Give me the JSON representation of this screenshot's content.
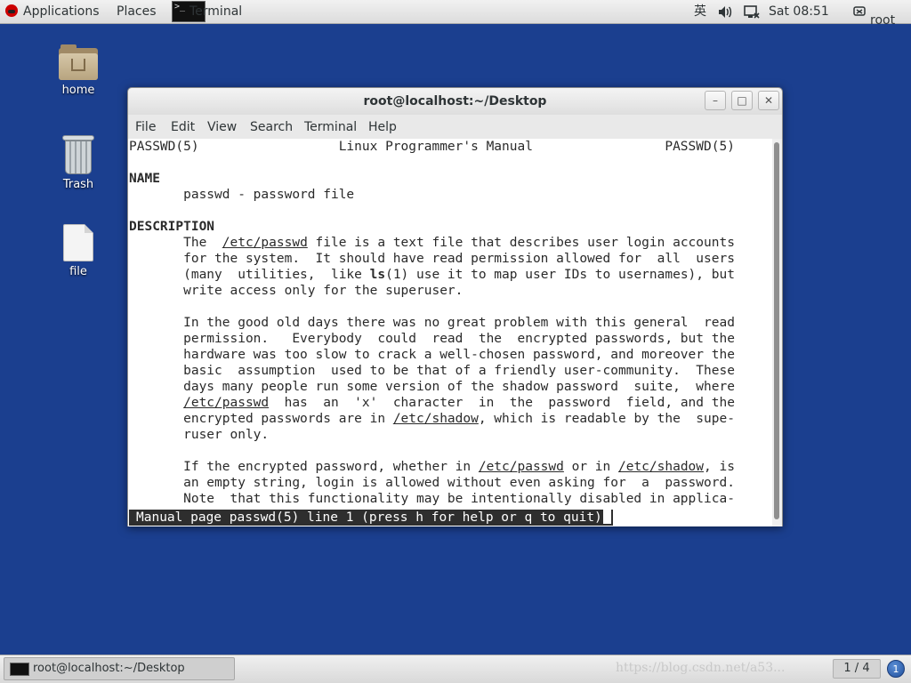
{
  "top_panel": {
    "applications_label": "Applications",
    "places_label": "Places",
    "terminal_label": "Terminal",
    "input_method": "英",
    "clock": "Sat 08:51",
    "user": "root"
  },
  "desktop": {
    "icons": [
      {
        "label": "home",
        "icon": "home-folder-icon"
      },
      {
        "label": "Trash",
        "icon": "trash-icon"
      },
      {
        "label": "file",
        "icon": "file-icon"
      }
    ]
  },
  "window": {
    "title": "root@localhost:~/Desktop",
    "menu": [
      "File",
      "Edit",
      "View",
      "Search",
      "Terminal",
      "Help"
    ],
    "status_line": "Manual page passwd(5) line 1 (press h for help or q to quit)",
    "lines": [
      "PASSWD(5)                  Linux Programmer's Manual                 PASSWD(5)",
      "",
      "NAME",
      "       passwd - password file",
      "",
      "DESCRIPTION",
      "       The  /etc/passwd file is a text file that describes user login accounts",
      "       for the system.  It should have read permission allowed for  all  users",
      "       (many  utilities,  like ls(1) use it to map user IDs to usernames), but",
      "       write access only for the superuser.",
      "",
      "       In the good old days there was no great problem with this general  read",
      "       permission.   Everybody  could  read  the  encrypted passwords, but the",
      "       hardware was too slow to crack a well-chosen password, and moreover the",
      "       basic  assumption  used to be that of a friendly user-community.  These",
      "       days many people run some version of the shadow password  suite,  where",
      "       /etc/passwd  has  an  'x'  character  in  the  password  field, and the",
      "       encrypted passwords are in /etc/shadow, which is readable by the  supe‐",
      "       ruser only.",
      "",
      "       If the encrypted password, whether in /etc/passwd or in /etc/shadow, is",
      "       an empty string, login is allowed without even asking for  a  password.",
      "       Note  that this functionality may be intentionally disabled in applica‐"
    ]
  },
  "taskbar": {
    "task_label": "root@localhost:~/Desktop",
    "watermark": "https://blog.csdn.net/a53...",
    "workspace": "1 / 4",
    "notification_count": "1"
  },
  "colors": {
    "desktop_bg": "#1b3f8f",
    "status_bg": "#2e2e2e"
  }
}
